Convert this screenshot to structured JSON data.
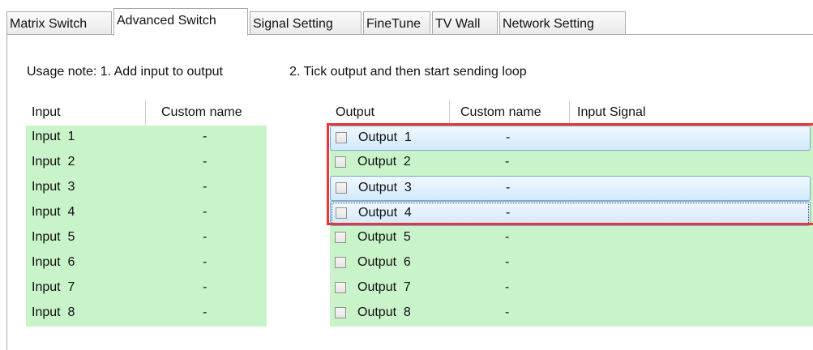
{
  "tabs": [
    "Matrix Switch",
    "Advanced Switch",
    "Signal Setting",
    "FineTune",
    "TV Wall",
    "Network Setting"
  ],
  "active_tab": "Advanced Switch",
  "usage_note": "Usage note: 1. Add input to output",
  "usage_note2": "2. Tick output and then start sending loop",
  "input_table": {
    "headers": [
      "Input",
      "Custom name"
    ],
    "rows": [
      {
        "name": "Input  1",
        "custom": "-"
      },
      {
        "name": "Input  2",
        "custom": "-"
      },
      {
        "name": "Input  3",
        "custom": "-"
      },
      {
        "name": "Input  4",
        "custom": "-"
      },
      {
        "name": "Input  5",
        "custom": "-"
      },
      {
        "name": "Input  6",
        "custom": "-"
      },
      {
        "name": "Input  7",
        "custom": "-"
      },
      {
        "name": "Input  8",
        "custom": "-"
      }
    ]
  },
  "output_table": {
    "headers": [
      "Output",
      "Custom name",
      "Input Signal"
    ],
    "rows": [
      {
        "name": "Output  1",
        "custom": "-",
        "signal": "",
        "checked": false,
        "selected": true
      },
      {
        "name": "Output  2",
        "custom": "-",
        "signal": "",
        "checked": false,
        "selected": false
      },
      {
        "name": "Output  3",
        "custom": "-",
        "signal": "",
        "checked": false,
        "selected": true
      },
      {
        "name": "Output  4",
        "custom": "-",
        "signal": "",
        "checked": false,
        "selected": true
      },
      {
        "name": "Output  5",
        "custom": "-",
        "signal": "",
        "checked": false,
        "selected": false
      },
      {
        "name": "Output  6",
        "custom": "-",
        "signal": "",
        "checked": false,
        "selected": false
      },
      {
        "name": "Output  7",
        "custom": "-",
        "signal": "",
        "checked": false,
        "selected": false
      },
      {
        "name": "Output  8",
        "custom": "-",
        "signal": "",
        "checked": false,
        "selected": false
      }
    ]
  },
  "colors": {
    "row_bg": "#c9f3c9",
    "highlight_border": "#e8363a",
    "selection": "#d3e9fb"
  }
}
